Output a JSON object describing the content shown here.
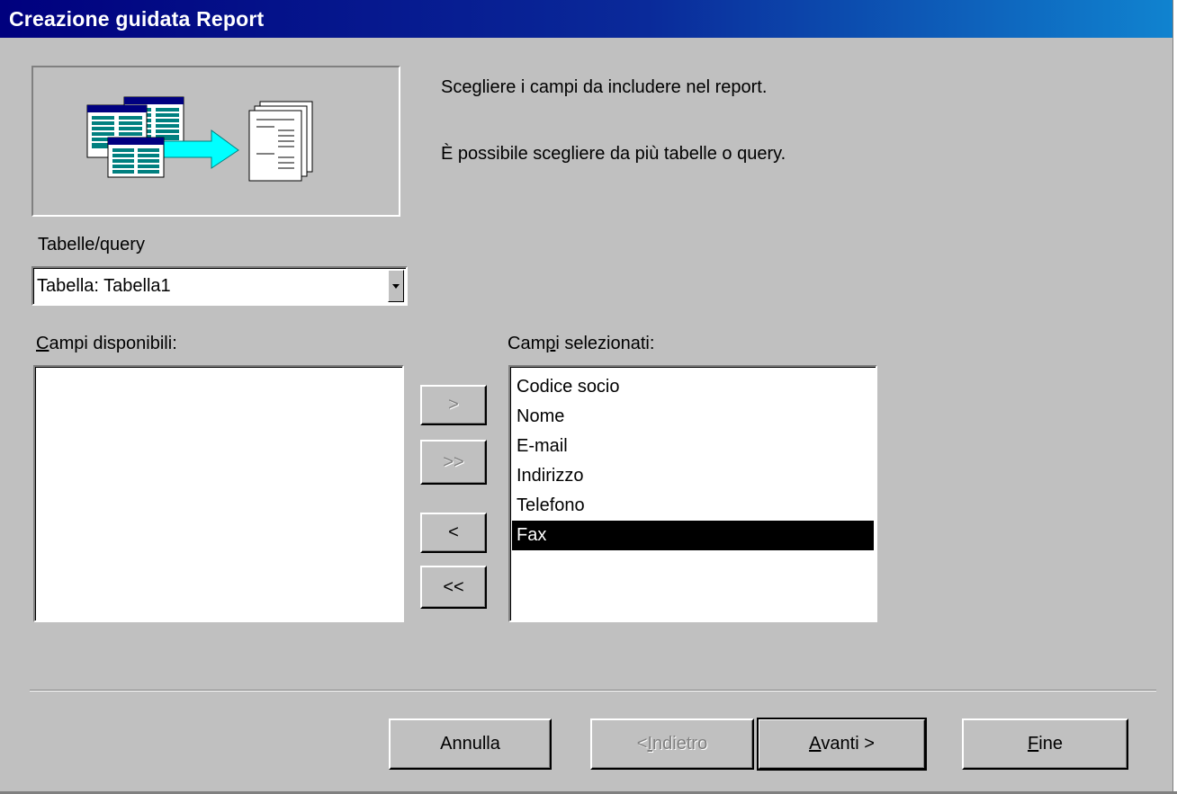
{
  "window": {
    "title": "Creazione guidata Report"
  },
  "intro": {
    "line1": "Scegliere i campi da includere nel report.",
    "line2": "È possibile scegliere da più tabelle o query."
  },
  "tables_queries": {
    "label": "Tabelle/query",
    "value": "Tabella: Tabella1"
  },
  "available_fields": {
    "label_pre": "",
    "label_mnemonic": "C",
    "label_post": "ampi disponibili:",
    "items": []
  },
  "selected_fields": {
    "label_pre": "Cam",
    "label_mnemonic": "p",
    "label_post": "i selezionati:",
    "items": [
      "Codice socio",
      "Nome",
      "E-mail",
      "Indirizzo",
      "Telefono",
      "Fax"
    ],
    "selected_item": "Fax"
  },
  "move_buttons": {
    "add_one": ">",
    "add_all": ">>",
    "remove_one": "<",
    "remove_all": "<<"
  },
  "footer": {
    "cancel": "Annulla",
    "back_pre": "< ",
    "back_mnemonic": "I",
    "back_post": "ndietro",
    "next_mnemonic": "A",
    "next_post": "vanti >",
    "finish_mnemonic": "F",
    "finish_post": "ine"
  }
}
